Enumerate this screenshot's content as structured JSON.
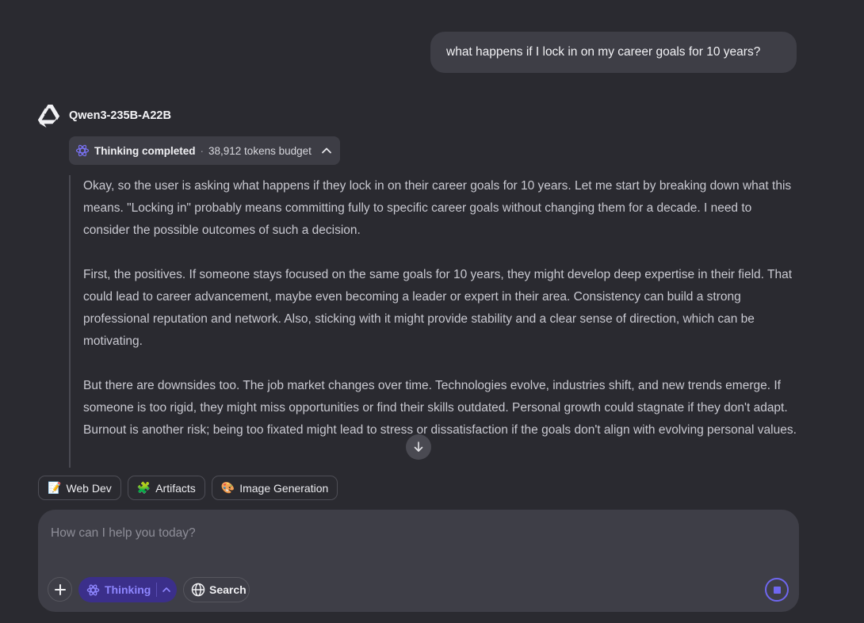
{
  "conversation": {
    "user_message": "what happens if I lock in on my career goals for 10 years?",
    "assistant": {
      "model_name": "Qwen3-235B-A22B",
      "thinking_status": "Thinking completed",
      "separator": "·",
      "tokens_budget": "38,912 tokens budget",
      "thought_paragraphs": [
        "Okay, so the user is asking what happens if they lock in on their career goals for 10 years. Let me start by breaking down what this means. \"Locking in\" probably means committing fully to specific career goals without changing them for a decade. I need to consider the possible outcomes of such a decision.",
        "First, the positives. If someone stays focused on the same goals for 10 years, they might develop deep expertise in their field. That could lead to career advancement, maybe even becoming a leader or expert in their area. Consistency can build a strong professional reputation and network. Also, sticking with it might provide stability and a clear sense of direction, which can be motivating.",
        "But there are downsides too. The job market changes over time. Technologies evolve, industries shift, and new trends emerge. If someone is too rigid, they might miss opportunities or find their skills outdated. Personal growth could stagnate if they don't adapt. Burnout is another risk; being too fixated might lead to stress or dissatisfaction if the goals don't align with evolving personal values."
      ]
    }
  },
  "suggestions": [
    {
      "icon": "memo-icon",
      "emoji": "📝",
      "label": "Web Dev"
    },
    {
      "icon": "puzzle-icon",
      "emoji": "🧩",
      "label": "Artifacts"
    },
    {
      "icon": "palette-icon",
      "emoji": "🎨",
      "label": "Image Generation"
    }
  ],
  "composer": {
    "placeholder": "How can I help you today?",
    "thinking_label": "Thinking",
    "search_label": "Search"
  },
  "colors": {
    "background": "#2a2a30",
    "accent": "#6f67f0",
    "toggle_bg": "#3b2f8a"
  }
}
